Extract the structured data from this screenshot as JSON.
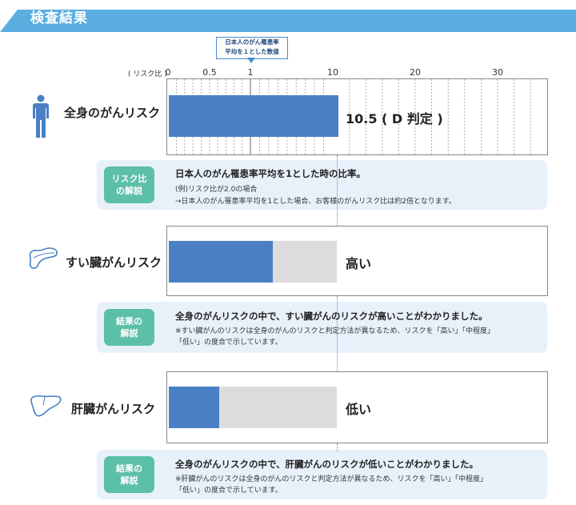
{
  "header": {
    "title": "検査結果",
    "color": "#5aaee0"
  },
  "callout": {
    "line1": "日本人のがん罹患率",
    "line2": "平均を１とした数値"
  },
  "axis": {
    "label": "( リスク比 )",
    "ticks": [
      {
        "value": 0,
        "label": "0"
      },
      {
        "value": 0.5,
        "label": "0.5"
      },
      {
        "value": 1,
        "label": "1"
      },
      {
        "value": 10,
        "label": "10"
      },
      {
        "value": 20,
        "label": "20"
      },
      {
        "value": 30,
        "label": "30"
      }
    ]
  },
  "colors": {
    "bar": "#4a7fc4",
    "bar_bg": "#dcdcdc",
    "badge": "#5cbfa8",
    "info_bg": "#e8f1fa"
  },
  "overall": {
    "label": "全身のがんリスク",
    "icon": "person-icon",
    "risk_ratio": 10.5,
    "result": "10.5 ( D 判定 )"
  },
  "info1": {
    "badge_line1": "リスク比",
    "badge_line2": "の解説",
    "main": "日本人のがん罹患率平均を1とした時の比率。",
    "sub1": "(例)リスク比が2.0の場合",
    "sub2": "→日本人のがん罹患率平均を1とした場合、お客様のがんリスク比は約2倍となります。"
  },
  "pancreas": {
    "label": "すい臓がんリスク",
    "icon": "pancreas-icon",
    "level_fraction": 0.62,
    "result": "高い"
  },
  "info2": {
    "badge_line1": "結果の",
    "badge_line2": "解説",
    "main": "全身のがんリスクの中で、すい臓がんのリスクが高いことがわかりました。",
    "sub1": "※すい臓がんのリスクは全身のがんのリスクと判定方法が異なるため、リスクを「高い」「中程度」",
    "sub2": "「低い」の度合で示しています。"
  },
  "liver": {
    "label": "肝臓がんリスク",
    "icon": "liver-icon",
    "level_fraction": 0.3,
    "result": "低い"
  },
  "info3": {
    "badge_line1": "結果の",
    "badge_line2": "解説",
    "main": "全身のがんリスクの中で、肝臓がんのリスクが低いことがわかりました。",
    "sub1": "※肝臓がんのリスクは全身のがんのリスクと判定方法が異なるため、リスクを「高い」「中程度」",
    "sub2": "「低い」の度合で示しています。"
  }
}
